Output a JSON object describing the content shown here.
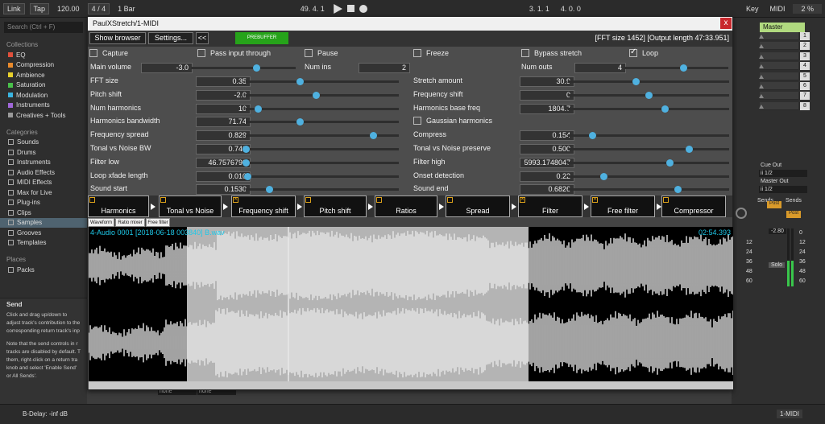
{
  "ableton": {
    "link": "Link",
    "tap": "Tap",
    "tempo": "120.00",
    "meter_sig": "4 / 4",
    "quant": "1 Bar",
    "position": "49.  4.  1",
    "loop_start": "3.  1.  1",
    "loop_length": "4.  0.  0",
    "key": "Key",
    "midi": "MIDI",
    "cpu": "2 %"
  },
  "browser": {
    "search_placeholder": "Search (Ctrl + F)",
    "collections_head": "Collections",
    "collections": [
      {
        "label": "EQ",
        "color": "#e0503c"
      },
      {
        "label": "Compression",
        "color": "#e88a2c"
      },
      {
        "label": "Ambience",
        "color": "#e8d02c"
      },
      {
        "label": "Saturation",
        "color": "#49c04a"
      },
      {
        "label": "Modulation",
        "color": "#3ab4e0"
      },
      {
        "label": "Instruments",
        "color": "#a067d8"
      },
      {
        "label": "Creatives + Tools",
        "color": "#9a9a9a"
      }
    ],
    "categories_head": "Categories",
    "categories": [
      "Sounds",
      "Drums",
      "Instruments",
      "Audio Effects",
      "MIDI Effects",
      "Max for Live",
      "Plug-ins",
      "Clips",
      "Samples",
      "Grooves",
      "Templates"
    ],
    "places_head": "Places",
    "places": [
      "Packs"
    ]
  },
  "info": {
    "title": "Send",
    "p1": "Click and drag up/down to adjust track's contribution to the corresponding return track's inp",
    "p2": "Note that the send controls in r tracks are disabled by default. T them, right-click on a return tra knob and select 'Enable Send' or All Sends'."
  },
  "mixer": {
    "master": "Master",
    "rows": [
      "1",
      "2",
      "3",
      "4",
      "5",
      "6",
      "7",
      "8"
    ],
    "cue_out_label": "Cue Out",
    "cue_out_value": "ii 1/2",
    "master_out_label": "Master Out",
    "master_out_value": "ii 1/2",
    "sends_a": "Sends",
    "sends_b": "Sends",
    "post_a": "Post",
    "post_b": "Post",
    "volume": "-2.80",
    "solo": "Solo",
    "scale": [
      "12",
      "24",
      "36",
      "48",
      "60"
    ],
    "scale_b": [
      "0",
      "12",
      "24",
      "36",
      "48",
      "60"
    ],
    "meter_level": 0.45
  },
  "statusbar": {
    "track_info": "B-Delay: -inf dB",
    "selected_track": "1-MIDI",
    "none_a": "none",
    "none_b": "none"
  },
  "plugin": {
    "title": "PaulXStretch/1-MIDI",
    "close": "x",
    "show_browser": "Show browser",
    "settings": "Settings...",
    "collapse": "<<",
    "prebuffer": "PREBUFFER",
    "fft_info": "[FFT size 1452] [Output length 47:33.951]",
    "checks": [
      {
        "label": "Capture",
        "checked": false
      },
      {
        "label": "Pass input through",
        "checked": false
      },
      {
        "label": "Pause",
        "checked": false
      },
      {
        "label": "Freeze",
        "checked": false
      },
      {
        "label": "Bypass stretch",
        "checked": false
      },
      {
        "label": "Loop",
        "checked": true
      }
    ],
    "main_volume": {
      "label": "Main volume",
      "value": "-3.0",
      "pos": 0.62
    },
    "num_ins": {
      "label": "Num ins",
      "value": "2"
    },
    "num_outs": {
      "label": "Num outs",
      "value": "4",
      "pos": 0.57
    },
    "params_left": [
      {
        "label": "FFT size",
        "value": "0.35",
        "pos": 0.35
      },
      {
        "label": "Pitch shift",
        "value": "-2.0",
        "pos": 0.46
      },
      {
        "label": "Num harmonics",
        "value": "10",
        "pos": 0.08
      },
      {
        "label": "Harmonics bandwidth",
        "value": "71.74",
        "pos": 0.35
      },
      {
        "label": "Frequency spread",
        "value": "0.829",
        "pos": 0.83
      },
      {
        "label": "Tonal vs Noise BW",
        "value": "0.740",
        "pos": 0.0
      },
      {
        "label": "Filter low",
        "value": "46.7576790",
        "pos": 0.0
      },
      {
        "label": "Loop xfade length",
        "value": "0.010",
        "pos": 0.01
      },
      {
        "label": "Sound start",
        "value": "0.1530",
        "pos": 0.15
      }
    ],
    "params_right": [
      {
        "label": "Stretch amount",
        "value": "30.9",
        "pos": 0.42
      },
      {
        "label": "Frequency shift",
        "value": "0",
        "pos": 0.5
      },
      {
        "label": "Harmonics base freq",
        "value": "1804.7",
        "pos": 0.6
      },
      {
        "label": "Gaussian harmonics",
        "value": "",
        "pos": null,
        "check": true
      },
      {
        "label": "Compress",
        "value": "0.154",
        "pos": 0.15
      },
      {
        "label": "Tonal vs Noise preserve",
        "value": "0.500",
        "pos": 0.75
      },
      {
        "label": "Filter high",
        "value": "5993.1748047",
        "pos": 0.63
      },
      {
        "label": "Onset detection",
        "value": "0.22",
        "pos": 0.22
      },
      {
        "label": "Sound end",
        "value": "0.6826",
        "pos": 0.68
      }
    ],
    "modules": [
      {
        "label": "Harmonics",
        "on": false
      },
      {
        "label": "Tonal vs Noise",
        "on": false
      },
      {
        "label": "Frequency shift",
        "on": true
      },
      {
        "label": "Pitch shift",
        "on": false
      },
      {
        "label": "Ratios",
        "on": false
      },
      {
        "label": "Spread",
        "on": false
      },
      {
        "label": "Filter",
        "on": true
      },
      {
        "label": "Free filter",
        "on": true
      },
      {
        "label": "Compressor",
        "on": false
      }
    ],
    "tabs": [
      "Waveform",
      "Ratio mixer",
      "Free filter"
    ],
    "wave_file": "4-Audio 0001 [2018-06-18 003840] B.wav",
    "wave_time": "02:54.393",
    "selection_start": 0.153,
    "selection_end": 0.6826,
    "playhead": 0.31
  }
}
